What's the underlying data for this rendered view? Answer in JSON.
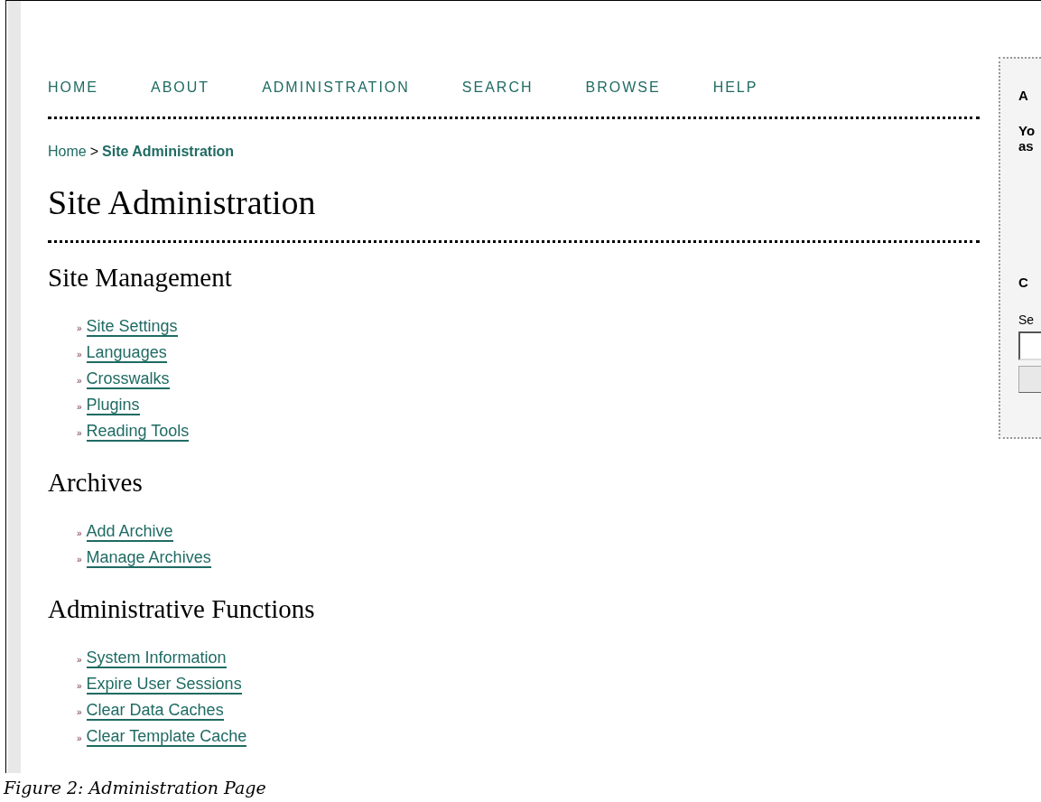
{
  "nav": [
    "HOME",
    "ABOUT",
    "ADMINISTRATION",
    "SEARCH",
    "BROWSE",
    "HELP"
  ],
  "breadcrumb": {
    "home": "Home",
    "separator": ">",
    "current": "Site Administration"
  },
  "title": "Site Administration",
  "sections": [
    {
      "heading": "Site Management",
      "links": [
        "Site Settings",
        "Languages",
        "Crosswalks",
        "Plugins",
        "Reading Tools"
      ]
    },
    {
      "heading": "Archives",
      "links": [
        "Add Archive",
        "Manage Archives"
      ]
    },
    {
      "heading": "Administrative Functions",
      "links": [
        "System Information",
        "Expire User Sessions",
        "Clear Data Caches",
        "Clear Template Cache"
      ]
    }
  ],
  "bullet": "»",
  "sidebar": {
    "block_1": {
      "title": "A",
      "lines": [
        "Yo",
        "as"
      ]
    },
    "block_2": {
      "title": "C",
      "label": "Se"
    }
  },
  "caption": "Figure 2: Administration Page"
}
